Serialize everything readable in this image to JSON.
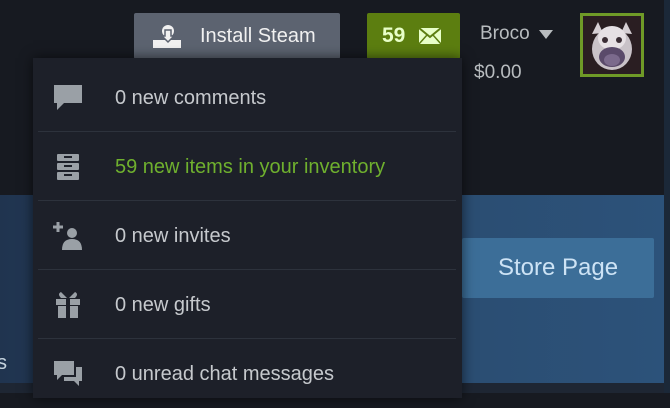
{
  "header": {
    "install_steam_label": "Install Steam",
    "notification_count": "59",
    "username": "Broco",
    "wallet_balance": "$0.00"
  },
  "notifications": [
    {
      "icon": "comment-icon",
      "text": "0 new comments",
      "highlight": false
    },
    {
      "icon": "inventory-icon",
      "text": "59 new items in your inventory",
      "highlight": true
    },
    {
      "icon": "invite-icon",
      "text": "0 new invites",
      "highlight": false
    },
    {
      "icon": "gift-icon",
      "text": "0 new gifts",
      "highlight": false
    },
    {
      "icon": "chat-icon",
      "text": "0 unread chat messages",
      "highlight": false
    }
  ],
  "page": {
    "store_page_label": "Store Page",
    "side_text": "s"
  },
  "colors": {
    "header_bg": "#171a21",
    "install_button": "#5c6370",
    "notification_button": "#5c7e10",
    "highlight_text": "#6fb02e",
    "dropdown_bg": "#1d2029",
    "store_page_button": "#3c6e98"
  }
}
